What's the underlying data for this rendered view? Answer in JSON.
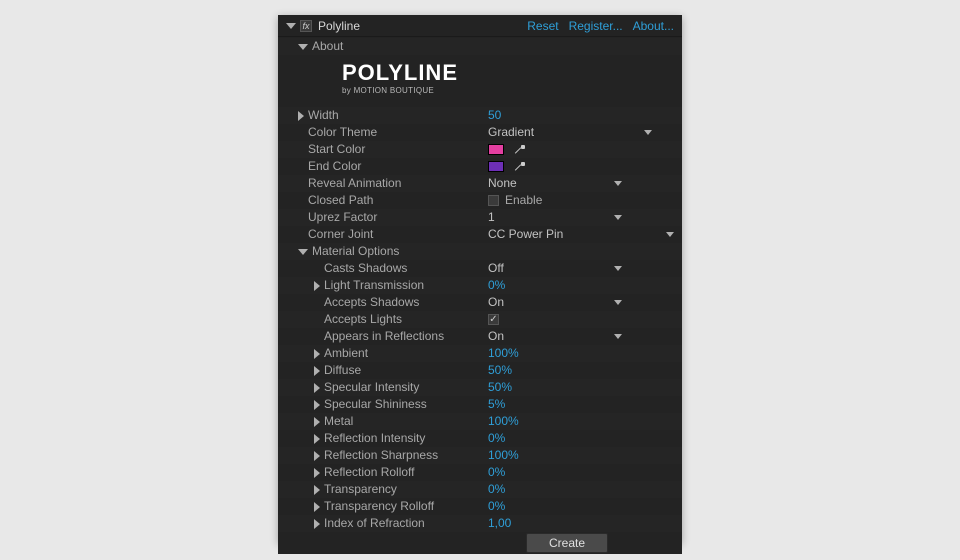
{
  "header": {
    "fx_icon_label": "fx",
    "title": "Polyline",
    "reset": "Reset",
    "register": "Register...",
    "about": "About..."
  },
  "about_group": {
    "label": "About",
    "logo_title": "POLYLINE",
    "logo_sub": "by MOTION BOUTIQUE"
  },
  "props": {
    "width": {
      "label": "Width",
      "value": "50"
    },
    "color_theme": {
      "label": "Color Theme",
      "value": "Gradient"
    },
    "start_color": {
      "label": "Start Color",
      "hex": "#e43fa1"
    },
    "end_color": {
      "label": "End Color",
      "hex": "#6d2fb6"
    },
    "reveal_animation": {
      "label": "Reveal Animation",
      "value": "None"
    },
    "closed_path": {
      "label": "Closed Path",
      "enable_text": "Enable",
      "checked": false
    },
    "uprez_factor": {
      "label": "Uprez Factor",
      "value": "1"
    },
    "corner_joint": {
      "label": "Corner Joint",
      "value": "CC Power Pin"
    }
  },
  "material": {
    "group_label": "Material Options",
    "casts_shadows": {
      "label": "Casts Shadows",
      "value": "Off"
    },
    "light_transmission": {
      "label": "Light Transmission",
      "value": "0%"
    },
    "accepts_shadows": {
      "label": "Accepts Shadows",
      "value": "On"
    },
    "accepts_lights": {
      "label": "Accepts Lights",
      "checked": true
    },
    "appears_in_reflections": {
      "label": "Appears in Reflections",
      "value": "On"
    },
    "ambient": {
      "label": "Ambient",
      "value": "100%"
    },
    "diffuse": {
      "label": "Diffuse",
      "value": "50%"
    },
    "specular_intensity": {
      "label": "Specular Intensity",
      "value": "50%"
    },
    "specular_shininess": {
      "label": "Specular Shininess",
      "value": "5%"
    },
    "metal": {
      "label": "Metal",
      "value": "100%"
    },
    "reflection_intensity": {
      "label": "Reflection Intensity",
      "value": "0%"
    },
    "reflection_sharpness": {
      "label": "Reflection Sharpness",
      "value": "100%"
    },
    "reflection_rolloff": {
      "label": "Reflection Rolloff",
      "value": "0%"
    },
    "transparency": {
      "label": "Transparency",
      "value": "0%"
    },
    "transparency_rolloff": {
      "label": "Transparency Rolloff",
      "value": "0%"
    },
    "index_of_refraction": {
      "label": "Index of Refraction",
      "value": "1,00"
    }
  },
  "create_button": "Create"
}
